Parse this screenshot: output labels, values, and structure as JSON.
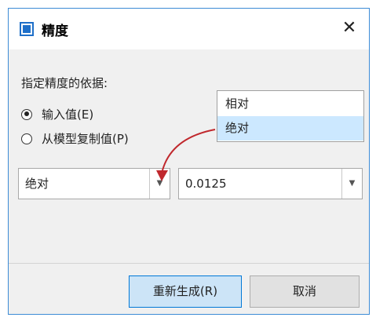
{
  "dialog": {
    "title": "精度",
    "close_glyph": "✕",
    "group_label": "指定精度的依据:",
    "radios": [
      {
        "label": "输入值(E)",
        "checked": true
      },
      {
        "label": "从模型复制值(P)",
        "checked": false
      }
    ],
    "popup_options": [
      {
        "label": "相对",
        "selected": false
      },
      {
        "label": "绝对",
        "selected": true
      }
    ],
    "mode_combo": {
      "value": "绝对",
      "arrow_icon": "dropdown-arrow-icon"
    },
    "value_combo": {
      "value": "0.0125",
      "arrow_icon": "dropdown-arrow-icon"
    },
    "buttons": {
      "regenerate": "重新生成(R)",
      "cancel": "取消"
    },
    "colors": {
      "accent": "#0078d7",
      "annotation_arrow": "#c0282d",
      "selected_option": "#cce8ff"
    }
  }
}
